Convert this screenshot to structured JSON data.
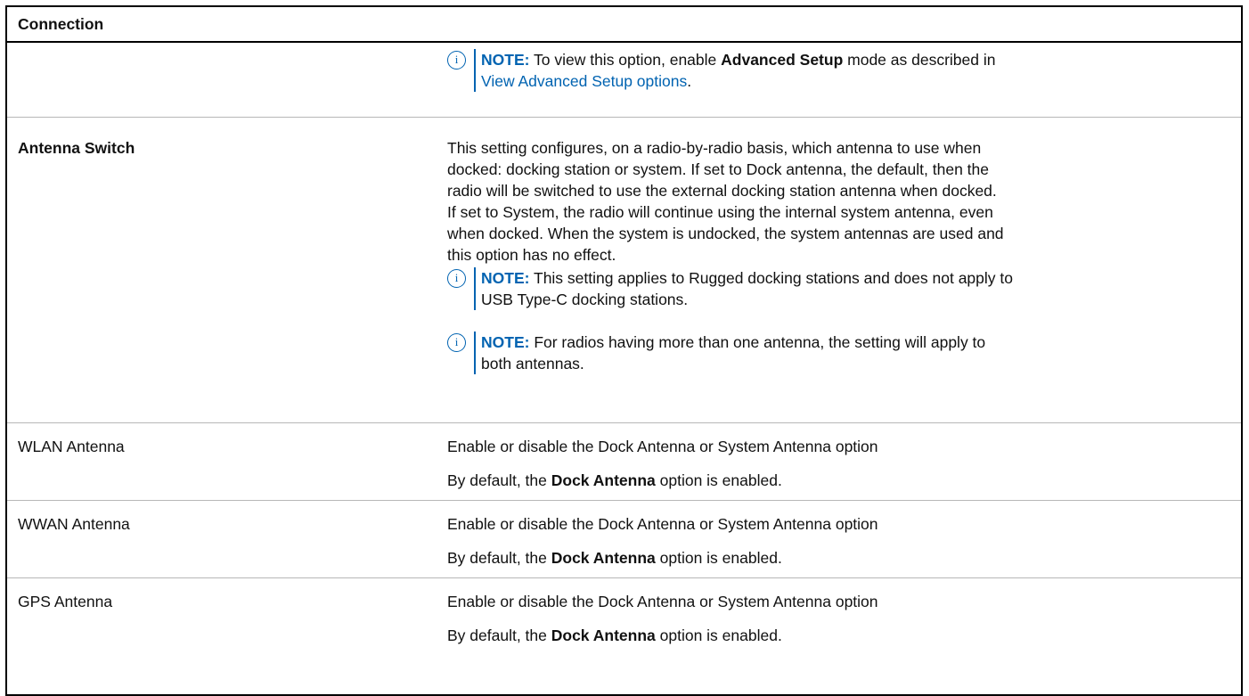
{
  "table": {
    "header": "Connection",
    "row0": {
      "note_label": "NOTE:",
      "note_pre": " To view this option, enable ",
      "note_bold": "Advanced Setup",
      "note_mid": " mode as described in",
      "note_link": "View Advanced Setup options",
      "note_post": "."
    },
    "antenna_switch": {
      "label": "Antenna Switch",
      "lines": [
        "This setting configures, on a radio-by-radio basis, which antenna to use when",
        "docked: docking station or system. If set to Dock antenna, the default, then the",
        "radio will be switched to use the external docking station antenna when docked.",
        "If set to System, the radio will continue using the internal system antenna, even",
        "when docked. When the system is undocked, the system antennas are used and",
        "this option has no effect."
      ],
      "note1_label": "NOTE:",
      "note1_line1": " This setting applies to Rugged docking stations and does not apply to",
      "note1_line2": "USB Type-C docking stations.",
      "note2_label": "NOTE:",
      "note2_line1": " For radios having more than one antenna, the setting will apply to",
      "note2_line2": "both antennas."
    },
    "rows": [
      {
        "label": "WLAN Antenna",
        "desc": "Enable or disable the Dock Antenna or System Antenna option",
        "default_pre": "By default, the ",
        "default_bold": "Dock Antenna",
        "default_post": " option is enabled."
      },
      {
        "label": "WWAN Antenna",
        "desc": "Enable or disable the Dock Antenna or System Antenna option",
        "default_pre": "By default, the ",
        "default_bold": "Dock Antenna",
        "default_post": " option is enabled."
      },
      {
        "label": "GPS Antenna",
        "desc": "Enable or disable the Dock Antenna or System Antenna option",
        "default_pre": "By default, the ",
        "default_bold": "Dock Antenna",
        "default_post": " option is enabled."
      }
    ],
    "info_icon_glyph": "i",
    "accent_color": "#0063b1"
  }
}
